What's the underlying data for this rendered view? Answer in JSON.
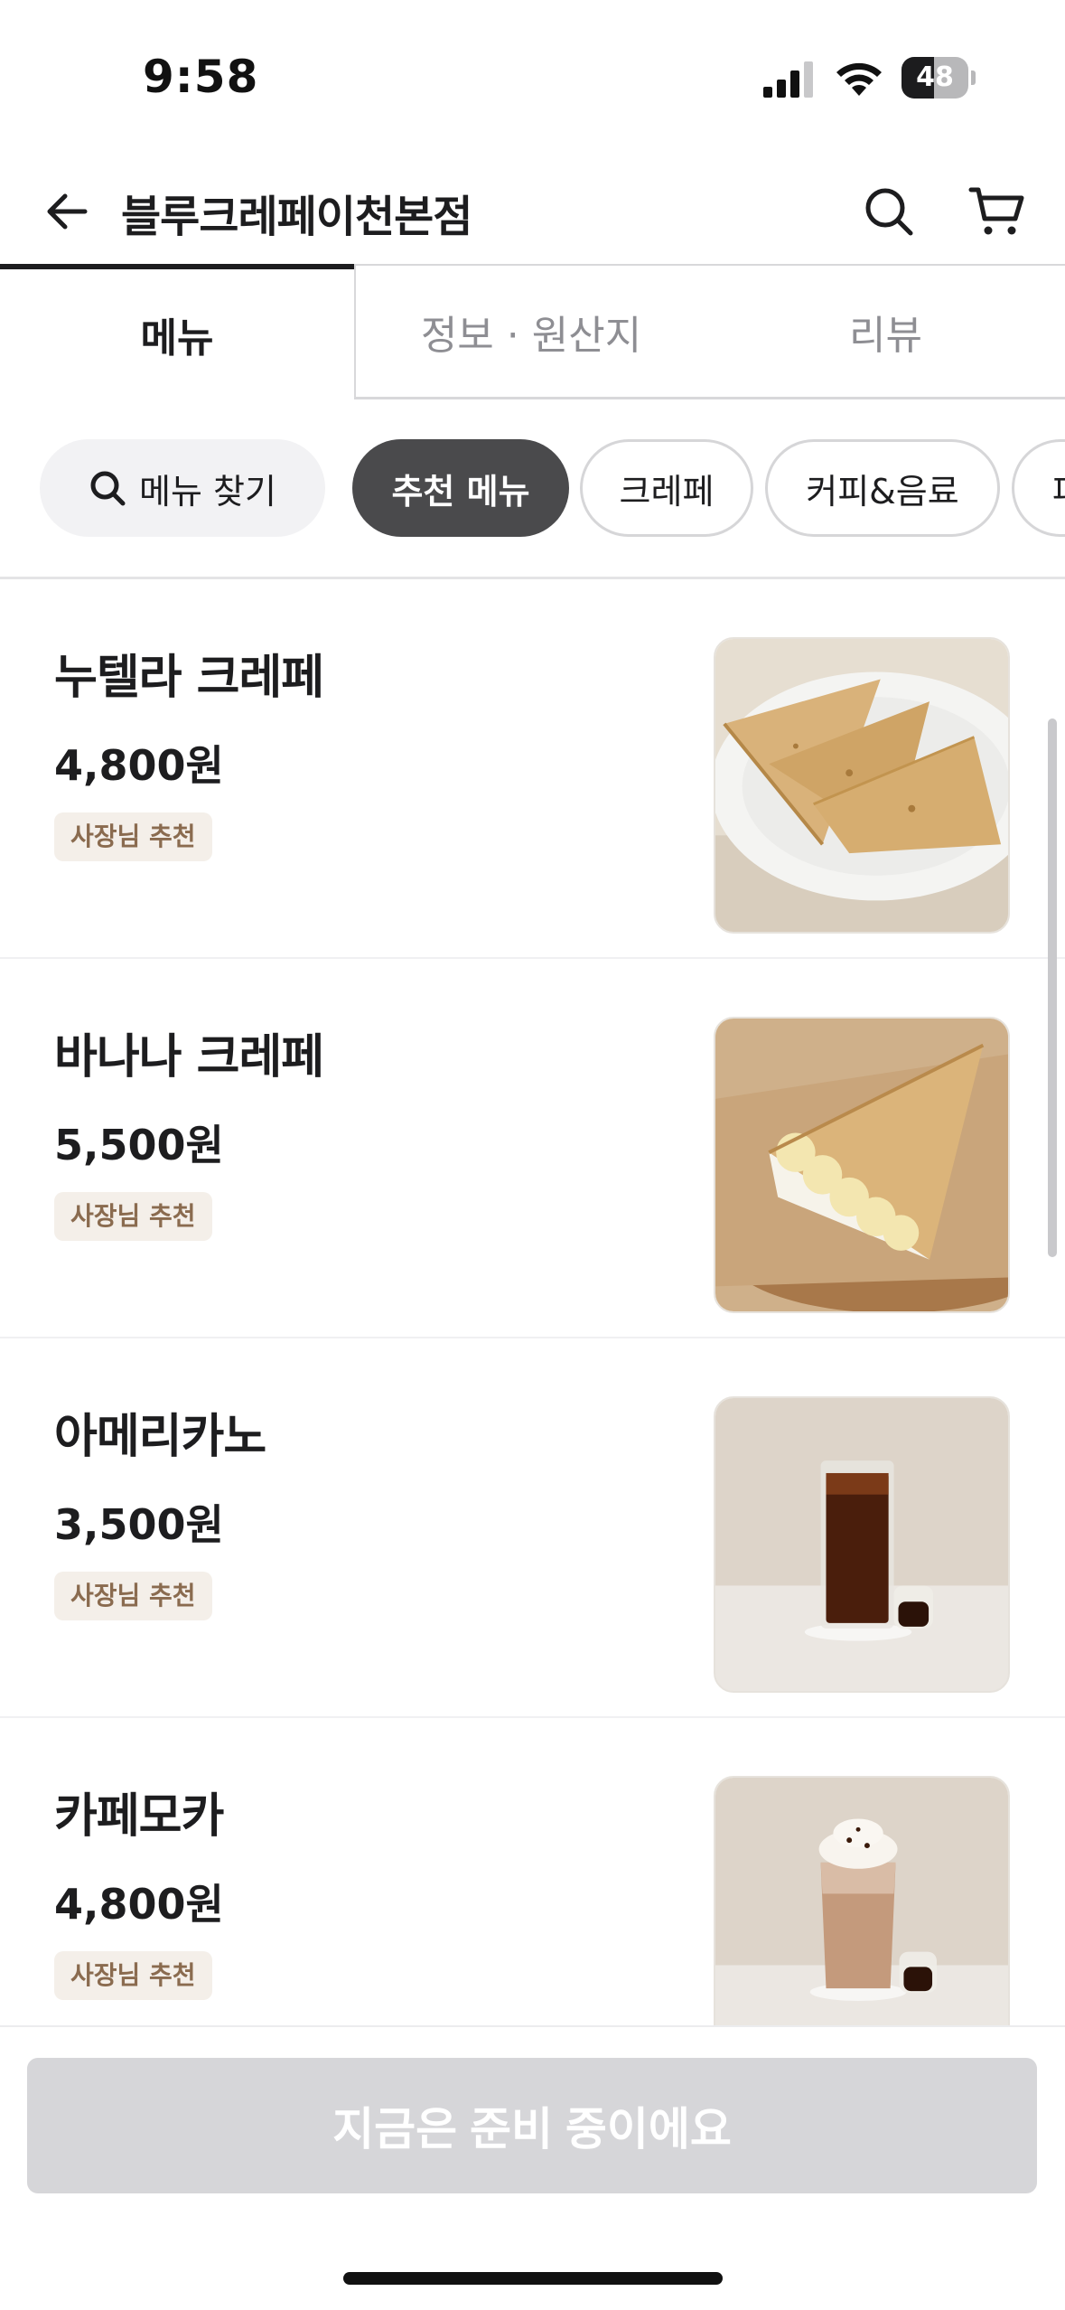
{
  "status_bar": {
    "time": "9:58",
    "battery": "48",
    "battery_level": 0.48,
    "icons": [
      "cellular-signal-icon",
      "wifi-icon",
      "battery-icon"
    ]
  },
  "header": {
    "title": "블루크레페이천본점",
    "icons": [
      "back-arrow-icon",
      "search-icon",
      "cart-icon"
    ]
  },
  "tabs": [
    {
      "label": "메뉴",
      "active": true
    },
    {
      "label": "정보 · 원산지",
      "active": false
    },
    {
      "label": "리뷰",
      "active": false
    }
  ],
  "chips": {
    "search_label": "메뉴 찾기",
    "items": [
      {
        "label": "추천 메뉴",
        "selected": true
      },
      {
        "label": "크레페",
        "selected": false
      },
      {
        "label": "커피&음료",
        "selected": false
      },
      {
        "label": "파",
        "selected": false
      }
    ]
  },
  "menu_items": [
    {
      "name": "누텔라 크레페",
      "price": "4,800원",
      "badge": "사장님 추천",
      "image": "folded-crepes-on-white-plate"
    },
    {
      "name": "바나나 크레페",
      "price": "5,500원",
      "badge": "사장님 추천",
      "image": "banana-crepe-on-wooden-plate"
    },
    {
      "name": "아메리카노",
      "price": "3,500원",
      "badge": "사장님 추천",
      "image": "iced-americano-glass"
    },
    {
      "name": "카페모카",
      "price": "4,800원",
      "badge": "사장님 추천",
      "image": "iced-cafe-mocha-glass"
    }
  ],
  "bottom": {
    "button_label": "지금은 준비 중이에요"
  },
  "colors": {
    "primary_text": "#1d1d1f",
    "secondary_text": "#8e8e93",
    "selected_chip": "#4a4a4c",
    "badge_bg": "#f4efe9",
    "badge_text": "#8a6b4f",
    "disabled_button": "#d6d6d9"
  }
}
